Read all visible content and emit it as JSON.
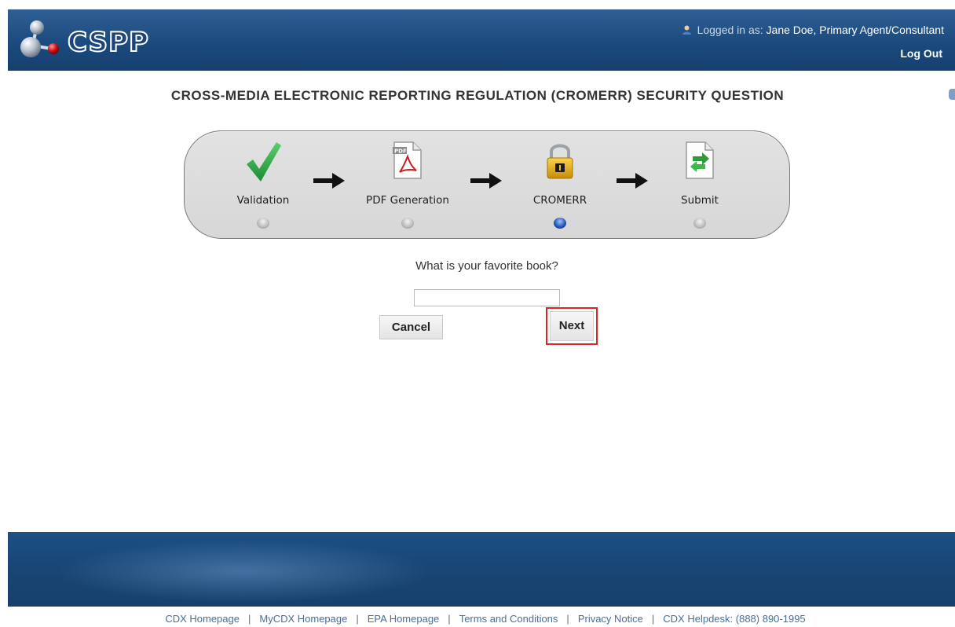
{
  "header": {
    "logo_text": "CSPP",
    "logged_in_label": "Logged in as:",
    "user_name": "Jane Doe, Primary Agent/Consultant",
    "logout_label": "Log Out"
  },
  "page_title": "CROSS-MEDIA ELECTRONIC REPORTING REGULATION (CROMERR) SECURITY QUESTION",
  "workflow": {
    "steps": [
      {
        "label": "Validation",
        "icon": "checkmark-icon",
        "active": false
      },
      {
        "label": "PDF Generation",
        "icon": "pdf-icon",
        "active": false
      },
      {
        "label": "CROMERR",
        "icon": "lock-icon",
        "active": true
      },
      {
        "label": "Submit",
        "icon": "submit-document-icon",
        "active": false
      }
    ]
  },
  "question": {
    "text": "What is your favorite book?",
    "answer_value": ""
  },
  "buttons": {
    "cancel_label": "Cancel",
    "next_label": "Next"
  },
  "footer": {
    "links": [
      "CDX Homepage",
      "MyCDX Homepage",
      "EPA Homepage",
      "Terms and Conditions",
      "Privacy Notice",
      "CDX Helpdesk: (888) 890-1995"
    ],
    "separator": "|"
  },
  "colors": {
    "header_bg": "#1b4a7e",
    "footer_bg": "#184675",
    "highlight_border": "#d9262c",
    "active_step_dot": "#1e4fb3"
  }
}
